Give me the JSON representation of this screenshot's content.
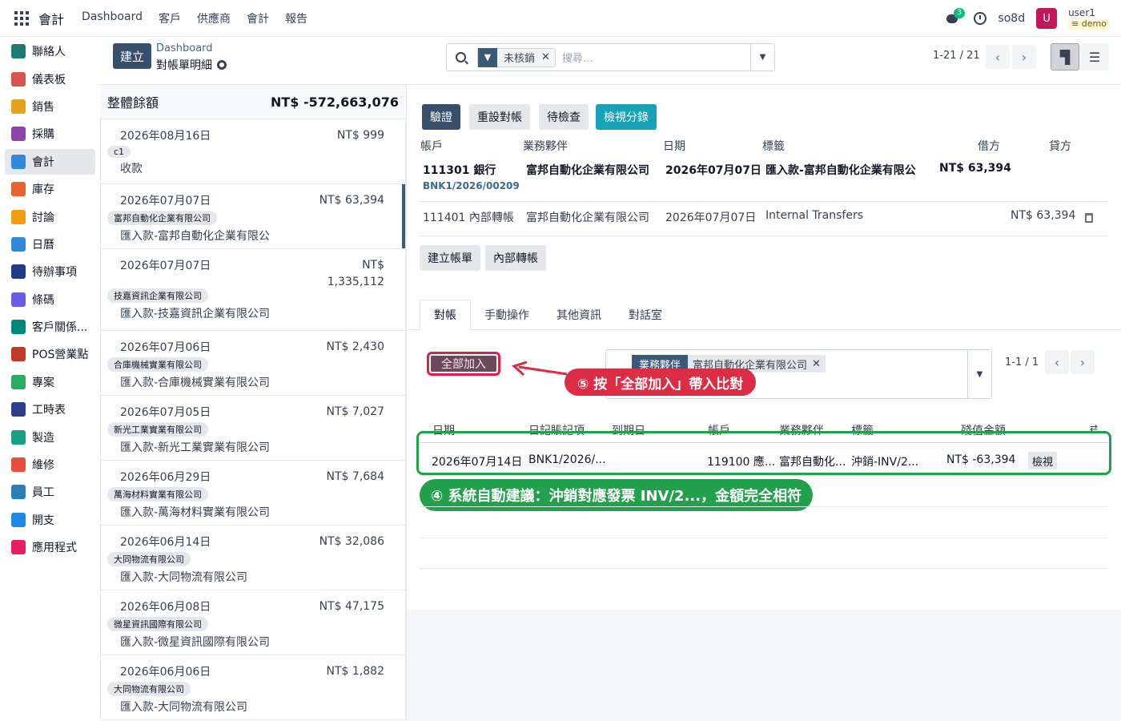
{
  "topbar": {
    "brand": "會計",
    "menu": [
      "Dashboard",
      "客戶",
      "供應商",
      "會計",
      "報告"
    ],
    "chat_count": "3",
    "company": "so8d",
    "avatar_letter": "U",
    "user": "user1",
    "db": "demo"
  },
  "sidebar": {
    "items": [
      {
        "label": "聯絡人",
        "color": "#1c7c73"
      },
      {
        "label": "儀表板",
        "color": "#d9534f"
      },
      {
        "label": "銷售",
        "color": "#e4a11b"
      },
      {
        "label": "採購",
        "color": "#8e44ad"
      },
      {
        "label": "會計",
        "color": "#2f8ad8"
      },
      {
        "label": "庫存",
        "color": "#e8632b"
      },
      {
        "label": "討論",
        "color": "#f39c12"
      },
      {
        "label": "日曆",
        "color": "#2f8ad8"
      },
      {
        "label": "待辦事項",
        "color": "#1f3c88"
      },
      {
        "label": "條碼",
        "color": "#6c5ce7"
      },
      {
        "label": "客戶關係...",
        "color": "#00897b"
      },
      {
        "label": "POS營業點",
        "color": "#c0392b"
      },
      {
        "label": "專案",
        "color": "#27ae60"
      },
      {
        "label": "工時表",
        "color": "#2d3e8f"
      },
      {
        "label": "製造",
        "color": "#16a085"
      },
      {
        "label": "維修",
        "color": "#e74c3c"
      },
      {
        "label": "員工",
        "color": "#2980b9"
      },
      {
        "label": "開支",
        "color": "#1e88e5"
      },
      {
        "label": "應用程式",
        "color": "#e91e63"
      }
    ]
  },
  "control_panel": {
    "create_label": "建立",
    "breadcrumb_parent": "Dashboard",
    "breadcrumb_current": "對帳單明細",
    "filter_facet": "未核銷",
    "search_placeholder": "搜尋…",
    "pager": "1-21 / 21"
  },
  "left_list": {
    "total_label": "整體餘額",
    "total_amount": "NT$ -572,663,076",
    "cards": [
      {
        "date": "2026年08月16日",
        "amount": "NT$ 999",
        "tag": "c1",
        "memo": "收款"
      },
      {
        "date": "2026年07月07日",
        "amount": "NT$ 63,394",
        "tag": "富邦自動化企業有限公司",
        "memo": "匯入款-富邦自動化企業有限公"
      },
      {
        "date": "2026年07月07日",
        "amount": "NT$ 1,335,112",
        "tag": "技嘉資訊企業有限公司",
        "memo": "匯入款-技嘉資訊企業有限公司"
      },
      {
        "date": "2026年07月06日",
        "amount": "NT$ 2,430",
        "tag": "合庫機械實業有限公司",
        "memo": "匯入款-合庫機械實業有限公司"
      },
      {
        "date": "2026年07月05日",
        "amount": "NT$ 7,027",
        "tag": "新光工業實業有限公司",
        "memo": "匯入款-新光工業實業有限公司"
      },
      {
        "date": "2026年06月29日",
        "amount": "NT$ 7,684",
        "tag": "萬海材料實業有限公司",
        "memo": "匯入款-萬海材料實業有限公司"
      },
      {
        "date": "2026年06月14日",
        "amount": "NT$ 32,086",
        "tag": "大同物流有限公司",
        "memo": "匯入款-大同物流有限公司"
      },
      {
        "date": "2026年06月08日",
        "amount": "NT$ 47,175",
        "tag": "微星資訊國際有限公司",
        "memo": "匯入款-微星資訊國際有限公司"
      },
      {
        "date": "2026年06月06日",
        "amount": "NT$ 1,882",
        "tag": "大同物流有限公司",
        "memo": "匯入款-大同物流有限公司"
      }
    ]
  },
  "form": {
    "actions": [
      "驗證",
      "重設對帳",
      "待檢查",
      "檢視分錄"
    ],
    "headers": {
      "account": "帳戶",
      "partner": "業務夥伴",
      "date": "日期",
      "label": "標籤",
      "debit": "借方",
      "credit": "貸方"
    },
    "line1": {
      "account": "111301 銀行",
      "ref": "BNK1/2026/00209",
      "partner": "富邦自動化企業有限公司",
      "date": "2026年07月07日",
      "label": "匯入款-富邦自動化企業有限公",
      "debit": "NT$ 63,394"
    },
    "line2": {
      "account": "111401 內部轉帳",
      "partner": "富邦自動化企業有限公司",
      "date": "2026年07月07日",
      "label": "Internal Transfers",
      "credit": "NT$ 63,394"
    },
    "sub_actions": [
      "建立帳單",
      "內部轉帳"
    ],
    "tabs": [
      "對帳",
      "手動操作",
      "其他資訊",
      "對話室"
    ],
    "add_all_label": "全部加入",
    "callout5": "⑤ 按「全部加入」帶入比對",
    "filter_key": "業務夥伴",
    "filter_value": "富邦自動化企業有限公司",
    "pager": "1-1 / 1",
    "grid_headers": {
      "date": "日期",
      "journal_item": "日記賬記項",
      "due_date": "到期日",
      "account": "帳戶",
      "partner": "業務夥伴",
      "label": "標籤",
      "residual": "殘值金額"
    },
    "row": {
      "date": "2026年07月14日",
      "journal_item": "BNK1/2026/...",
      "account": "119100 應...",
      "partner": "富邦自動化...",
      "label": "沖銷-INV/2...",
      "residual": "NT$ -63,394",
      "view": "檢視"
    },
    "callout4": "④ 系統自動建議：沖銷對應發票 INV/2...，金額完全相符"
  }
}
